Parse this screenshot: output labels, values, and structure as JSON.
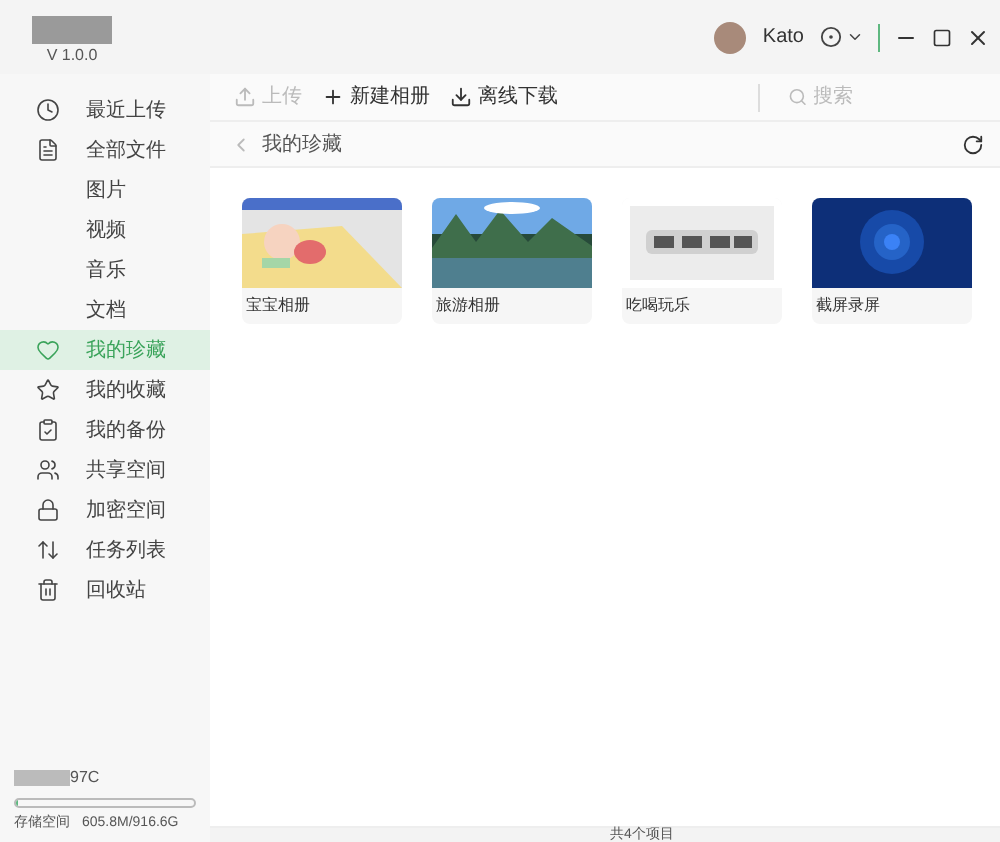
{
  "app": {
    "version": "V 1.0.0"
  },
  "user": {
    "name": "Kato"
  },
  "toolbar": {
    "buttons": [
      {
        "label": "上传",
        "disabled": true,
        "kind": "upload"
      },
      {
        "label": "新建相册",
        "disabled": false,
        "kind": "add"
      },
      {
        "label": "离线下载",
        "disabled": false,
        "kind": "download"
      }
    ],
    "search": {
      "placeholder": "搜索"
    }
  },
  "breadcrumb": "我的珍藏",
  "sidebar": {
    "items": [
      {
        "label": "最近上传",
        "kind": "clock",
        "selected": false
      },
      {
        "label": "全部文件",
        "kind": "file",
        "selected": false,
        "children": [
          {
            "label": "图片",
            "selected": false
          },
          {
            "label": "视频",
            "selected": false
          },
          {
            "label": "音乐",
            "selected": false
          },
          {
            "label": "文档",
            "selected": false
          }
        ]
      },
      {
        "label": "我的珍藏",
        "kind": "heart",
        "selected": true
      },
      {
        "label": "我的收藏",
        "kind": "star",
        "selected": false
      },
      {
        "label": "我的备份",
        "kind": "backup",
        "selected": false
      },
      {
        "label": "共享空间",
        "kind": "users",
        "selected": false
      },
      {
        "label": "加密空间",
        "kind": "lock",
        "selected": false
      },
      {
        "label": "任务列表",
        "kind": "sort",
        "selected": false
      },
      {
        "label": "回收站",
        "kind": "trash",
        "selected": false
      }
    ]
  },
  "device": {
    "name": "97C"
  },
  "storage": {
    "label": "存储空间",
    "reading": "605.8M/916.6G",
    "level": 0.01
  },
  "albums": [
    {
      "name": "宝宝相册",
      "kind": "baby"
    },
    {
      "name": "旅游相册",
      "kind": "lake"
    },
    {
      "name": "吃喝玩乐",
      "kind": "light"
    },
    {
      "name": "截屏录屏",
      "kind": "blue"
    }
  ],
  "status_bar": "共4个项目"
}
